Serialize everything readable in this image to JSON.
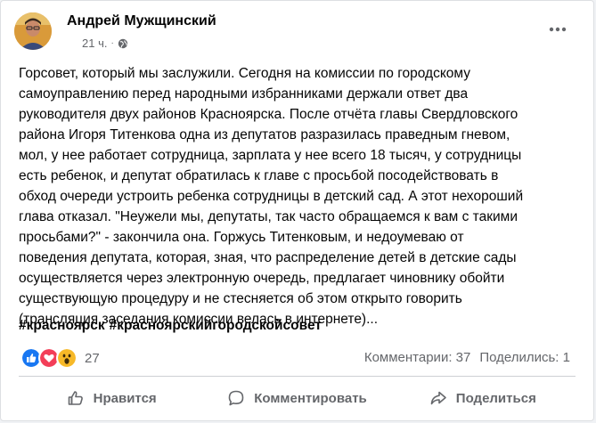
{
  "post": {
    "author": "Андрей Мужщинский",
    "time": "21 ч.",
    "separator": "·",
    "lines": [
      "Горсовет, который мы заслужили. Сегодня на комиссии по городскому",
      "самоуправлению перед народными избранниками держали ответ два",
      "руководителя двух районов Красноярска. После отчёта главы Свердловского",
      "района Игоря Титенкова одна из депутатов разразилась праведным гневом,",
      "мол, у нее работает сотрудница, зарплата у нее всего 18 тысяч, у сотрудницы",
      "есть ребенок, и депутат обратилась к главе с просьбой посодействовать в",
      "обход очереди устроить ребенка сотрудницы в детский сад. А этот нехороший",
      "глава отказал. \"Неужели мы, депутаты, так часто обращаемся к вам с такими",
      "просьбами?\" - закончила она. Горжусь Титенковым, и недоумеваю от",
      "поведения депутата, которая, зная, что распределение детей в детские сады",
      "осуществляется через электронную очередь, предлагает чиновнику обойти",
      "существующую процедуру и не стесняется об этом открыто говорить",
      "(трансляция заседания комиссии велась в интернете)..."
    ],
    "hashtags": [
      "#красноярск",
      "#красноярскийгородскойсовет"
    ]
  },
  "engagement": {
    "reaction_icons": [
      "like-icon",
      "love-icon",
      "wow-icon"
    ],
    "reaction_count": "27",
    "comments": "Комментарии: 37",
    "shares": "Поделились: 1"
  },
  "actions": {
    "like": "Нравится",
    "comment": "Комментировать",
    "share": "Поделиться"
  },
  "colors": {
    "like": "#1877f2",
    "love": "#f33e58",
    "wow": "#f7b928",
    "secondary_text": "#65676b"
  }
}
